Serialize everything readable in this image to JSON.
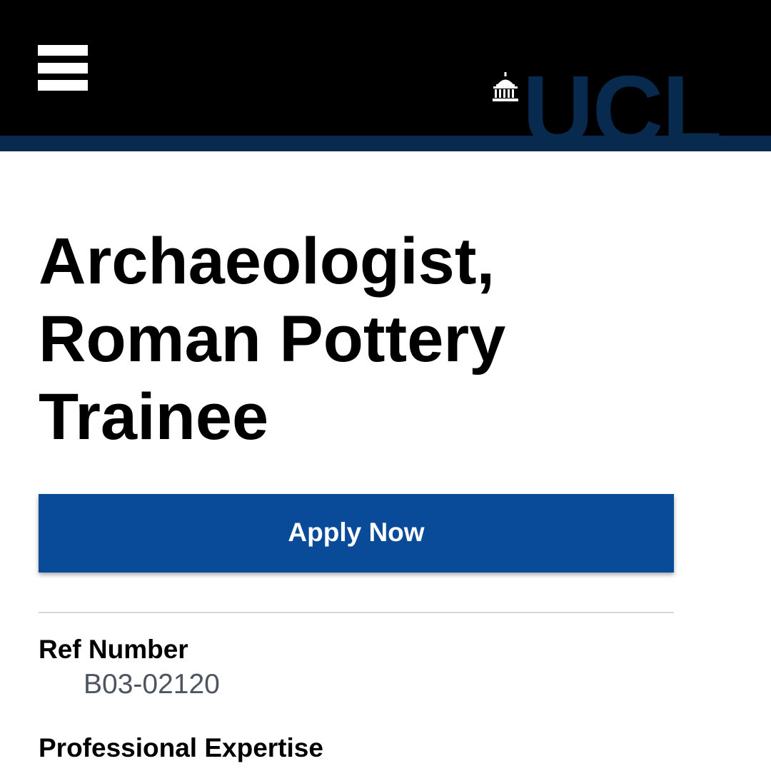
{
  "header": {
    "menu_icon": "hamburger-menu-icon",
    "logo_text": "UCL",
    "logo_icon": "portico-dome-icon",
    "background_color": "#000000",
    "stripe_color": "#082a4f",
    "logo_color": "#082a4f"
  },
  "job": {
    "title": "Archaeologist, Roman Pottery Trainee",
    "apply_label": "Apply Now",
    "apply_color": "#0a4b99"
  },
  "details": [
    {
      "label": "Ref Number",
      "value": "B03-02120"
    },
    {
      "label": "Professional Expertise",
      "value": null
    }
  ]
}
